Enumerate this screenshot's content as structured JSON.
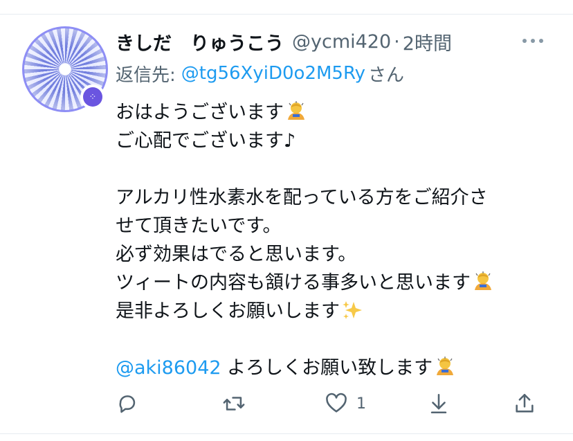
{
  "tweet": {
    "display_name": "きしだ　りゅうこう",
    "handle": "@ycmi420",
    "separator": "·",
    "time": "2時間",
    "reply_label": "返信先:",
    "reply_to": "@tg56XyiD0o2M5Ry",
    "reply_suffix": "さん",
    "body": {
      "l1": "おはようございます",
      "l2": "ご心配でございます♪",
      "l3": "アルカリ性水素水を配っている方をご紹介さ",
      "l4": "せて頂きたいです。",
      "l5": "必ず効果はでると思います。",
      "l6": "ツィートの内容も頷ける事多いと思います",
      "l7": "是非よろしくお願いします",
      "mention": "@aki86042",
      "l8": "よろしくお願い致します"
    },
    "like_count": "1"
  },
  "icons": {
    "emoji_bow": "person-bowing-emoji",
    "emoji_sparkles": "sparkles-emoji",
    "reply": "reply-icon",
    "retweet": "retweet-icon",
    "like": "heart-icon",
    "download": "download-icon",
    "share": "share-icon",
    "more": "more-icon"
  },
  "colors": {
    "link": "#1d9bf0",
    "secondary_text": "#536471",
    "primary_text": "#0f1419",
    "icon": "#536471"
  }
}
